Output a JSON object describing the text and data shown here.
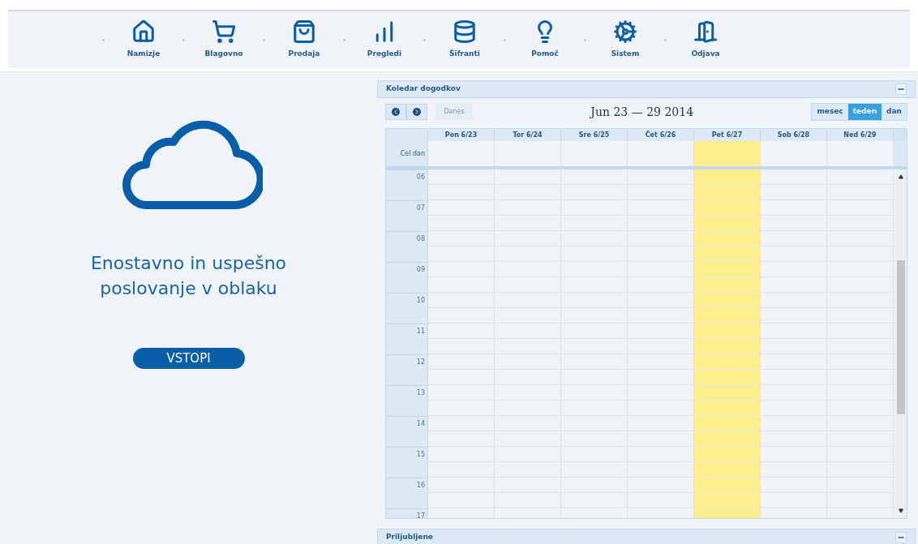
{
  "nav": [
    {
      "label": "Namizje",
      "kind": "home"
    },
    {
      "label": "Blagovno",
      "kind": "cart"
    },
    {
      "label": "Prodaja",
      "kind": "bag"
    },
    {
      "label": "Pregledi",
      "kind": "chart"
    },
    {
      "label": "Šifranti",
      "kind": "database"
    },
    {
      "label": "Pomoč",
      "kind": "bulb"
    },
    {
      "label": "Sistem",
      "kind": "cogs"
    },
    {
      "label": "Odjava",
      "kind": "door"
    }
  ],
  "promo": {
    "headline": "Enostavno in uspešno poslovanje v oblaku",
    "button": "VSTOPI"
  },
  "calendar": {
    "title": "Koledar dogodkov",
    "today_button": "Danes",
    "range": "Jun 23 — 29 2014",
    "views": [
      {
        "label": "mesec",
        "selected": false
      },
      {
        "label": "teden",
        "selected": true
      },
      {
        "label": "dan",
        "selected": false
      }
    ],
    "days": [
      {
        "label": "Pon 6/23",
        "today": false
      },
      {
        "label": "Tor 6/24",
        "today": false
      },
      {
        "label": "Sre 6/25",
        "today": false
      },
      {
        "label": "Čet 6/26",
        "today": false
      },
      {
        "label": "Pet 6/27",
        "today": true
      },
      {
        "label": "Sob 6/28",
        "today": false
      },
      {
        "label": "Ned 6/29",
        "today": false
      }
    ],
    "all_day": "Cel dan",
    "hours": [
      "06",
      "07",
      "08",
      "09",
      "10",
      "11",
      "12",
      "13",
      "14",
      "15",
      "16",
      "17"
    ]
  },
  "favorites": {
    "title": "Priljubljene"
  }
}
